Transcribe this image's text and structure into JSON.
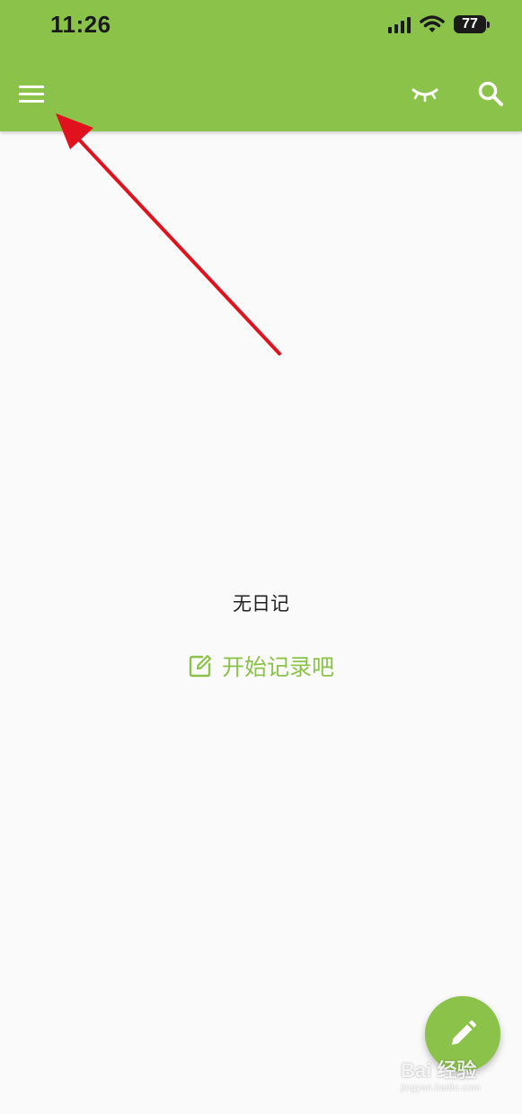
{
  "status_bar": {
    "time": "11:26",
    "battery": "77"
  },
  "toolbar": {
    "menu_icon": "hamburger-menu-icon",
    "eye_icon": "closed-eye-icon",
    "search_icon": "search-icon",
    "accent_color": "#8bc34a"
  },
  "main": {
    "empty_text": "无日记",
    "start_label": "开始记录吧",
    "start_icon": "edit-note-icon"
  },
  "fab": {
    "icon": "pencil-icon"
  },
  "annotation": {
    "color": "#e0121d"
  },
  "watermark": {
    "main": "Bai 经验",
    "sub": "jingyan.baidu.com"
  }
}
